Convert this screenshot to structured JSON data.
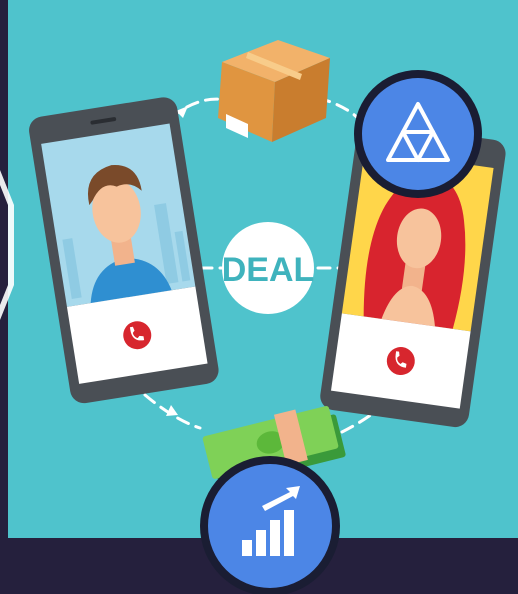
{
  "colors": {
    "frame_bg": "#25203d",
    "panel": "#4fc3cc",
    "phone_body": "#4a4f55",
    "badge_blue": "#4c86e6",
    "badge_border": "#1a1d33",
    "call_red": "#d7262e",
    "dash": "#ffffff"
  },
  "deal": {
    "label": "DEAL"
  },
  "icons": {
    "package": "package-icon",
    "brand": "triangle-logo-icon",
    "money": "money-stack-icon",
    "growth": "bar-chart-growth-icon",
    "call": "phone-call-icon"
  }
}
